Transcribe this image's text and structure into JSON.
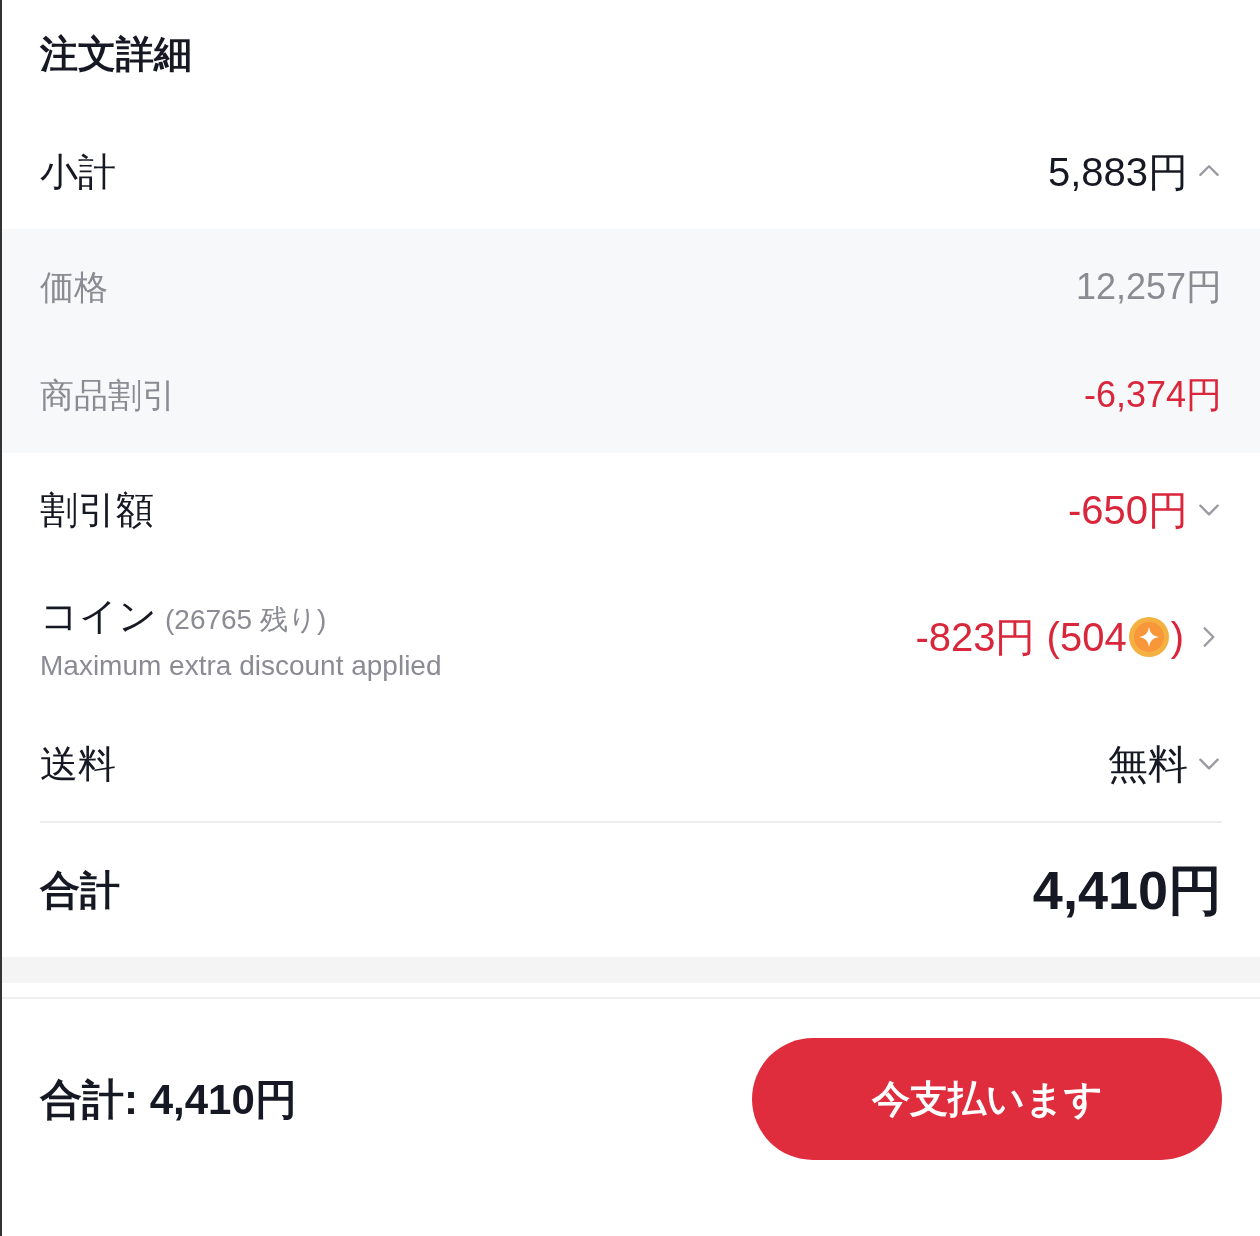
{
  "title": "注文詳細",
  "rows": [
    {
      "kind": "expandable",
      "label": "小計",
      "value": "5,883円",
      "negative": false,
      "expanded": true,
      "children": [
        {
          "label": "価格",
          "value": "12,257円",
          "negative": false
        },
        {
          "label": "商品割引",
          "value": "-6,374円",
          "negative": true
        }
      ]
    },
    {
      "kind": "expandable",
      "label": "割引額",
      "value": "-650円",
      "negative": true,
      "expanded": false
    },
    {
      "kind": "coin",
      "label": "コイン",
      "note": "(26765 残り)",
      "sub": "Maximum extra discount applied",
      "value": "-823円 (504",
      "value_end": ")",
      "negative": true
    },
    {
      "kind": "expandable",
      "label": "送料",
      "value": "無料",
      "negative": false,
      "expanded": false
    }
  ],
  "total": {
    "label": "合計",
    "value": "4,410円"
  },
  "footer": {
    "total": "合計: 4,410円",
    "button": "今支払います"
  }
}
